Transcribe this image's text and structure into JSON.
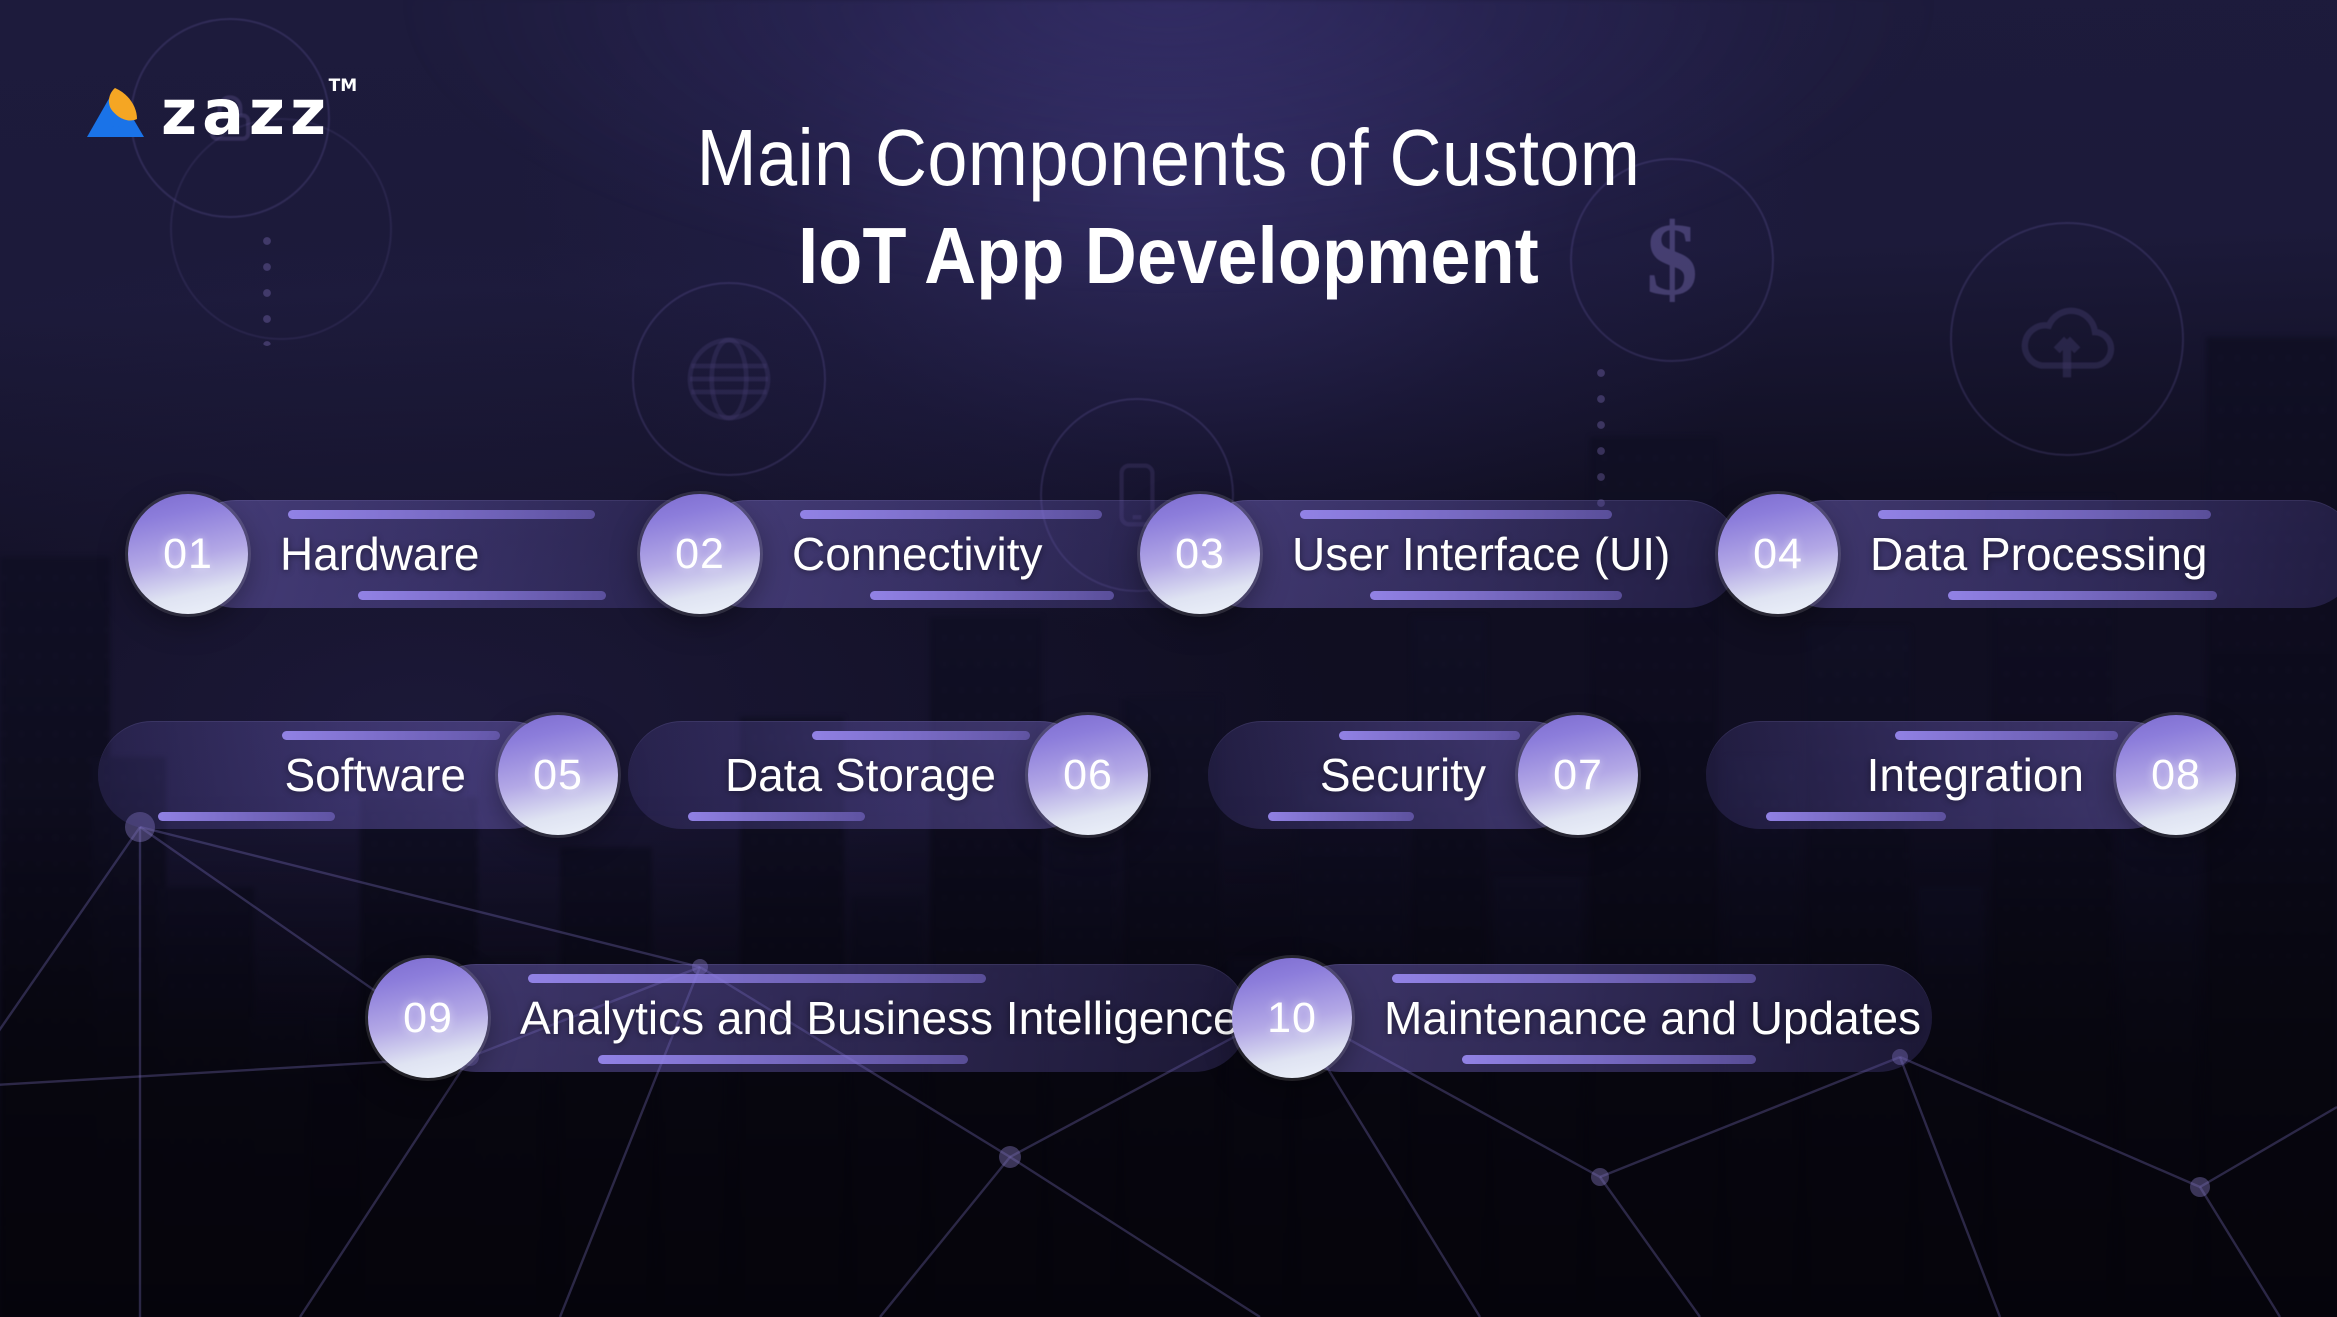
{
  "brand": {
    "name": "zazz",
    "tm": "TM",
    "mark_icon": "zazz-triangle-logo"
  },
  "title": {
    "line1": "Main Components of Custom",
    "line2": "IoT App Development"
  },
  "colors": {
    "accent_purple": "#7c6cce",
    "circle_light": "#eef3fb",
    "text": "#ffffff",
    "bg_top": "#1d1b3c",
    "bg_bottom": "#07060f",
    "logo_blue": "#1a73e8",
    "logo_yellow": "#f5a623"
  },
  "background_icons": [
    {
      "name": "lock-icon",
      "glyph": ""
    },
    {
      "name": "globe-icon",
      "glyph": ""
    },
    {
      "name": "dollar-icon",
      "glyph": "$"
    },
    {
      "name": "mobile-phone-icon",
      "glyph": ""
    },
    {
      "name": "cloud-upload-icon",
      "glyph": ""
    }
  ],
  "components": [
    {
      "num": "01",
      "label": "Hardware",
      "row": 1,
      "side": "left"
    },
    {
      "num": "02",
      "label": "Connectivity",
      "row": 1,
      "side": "left"
    },
    {
      "num": "03",
      "label": "User Interface (UI)",
      "row": 1,
      "side": "left"
    },
    {
      "num": "04",
      "label": "Data Processing",
      "row": 1,
      "side": "left"
    },
    {
      "num": "05",
      "label": "Software",
      "row": 2,
      "side": "right"
    },
    {
      "num": "06",
      "label": "Data Storage",
      "row": 2,
      "side": "right"
    },
    {
      "num": "07",
      "label": "Security",
      "row": 2,
      "side": "right"
    },
    {
      "num": "08",
      "label": "Integration",
      "row": 2,
      "side": "right"
    },
    {
      "num": "09",
      "label": "Analytics and Business Intelligence",
      "row": 3,
      "side": "left"
    },
    {
      "num": "10",
      "label": "Maintenance and Updates",
      "row": 3,
      "side": "left"
    }
  ]
}
